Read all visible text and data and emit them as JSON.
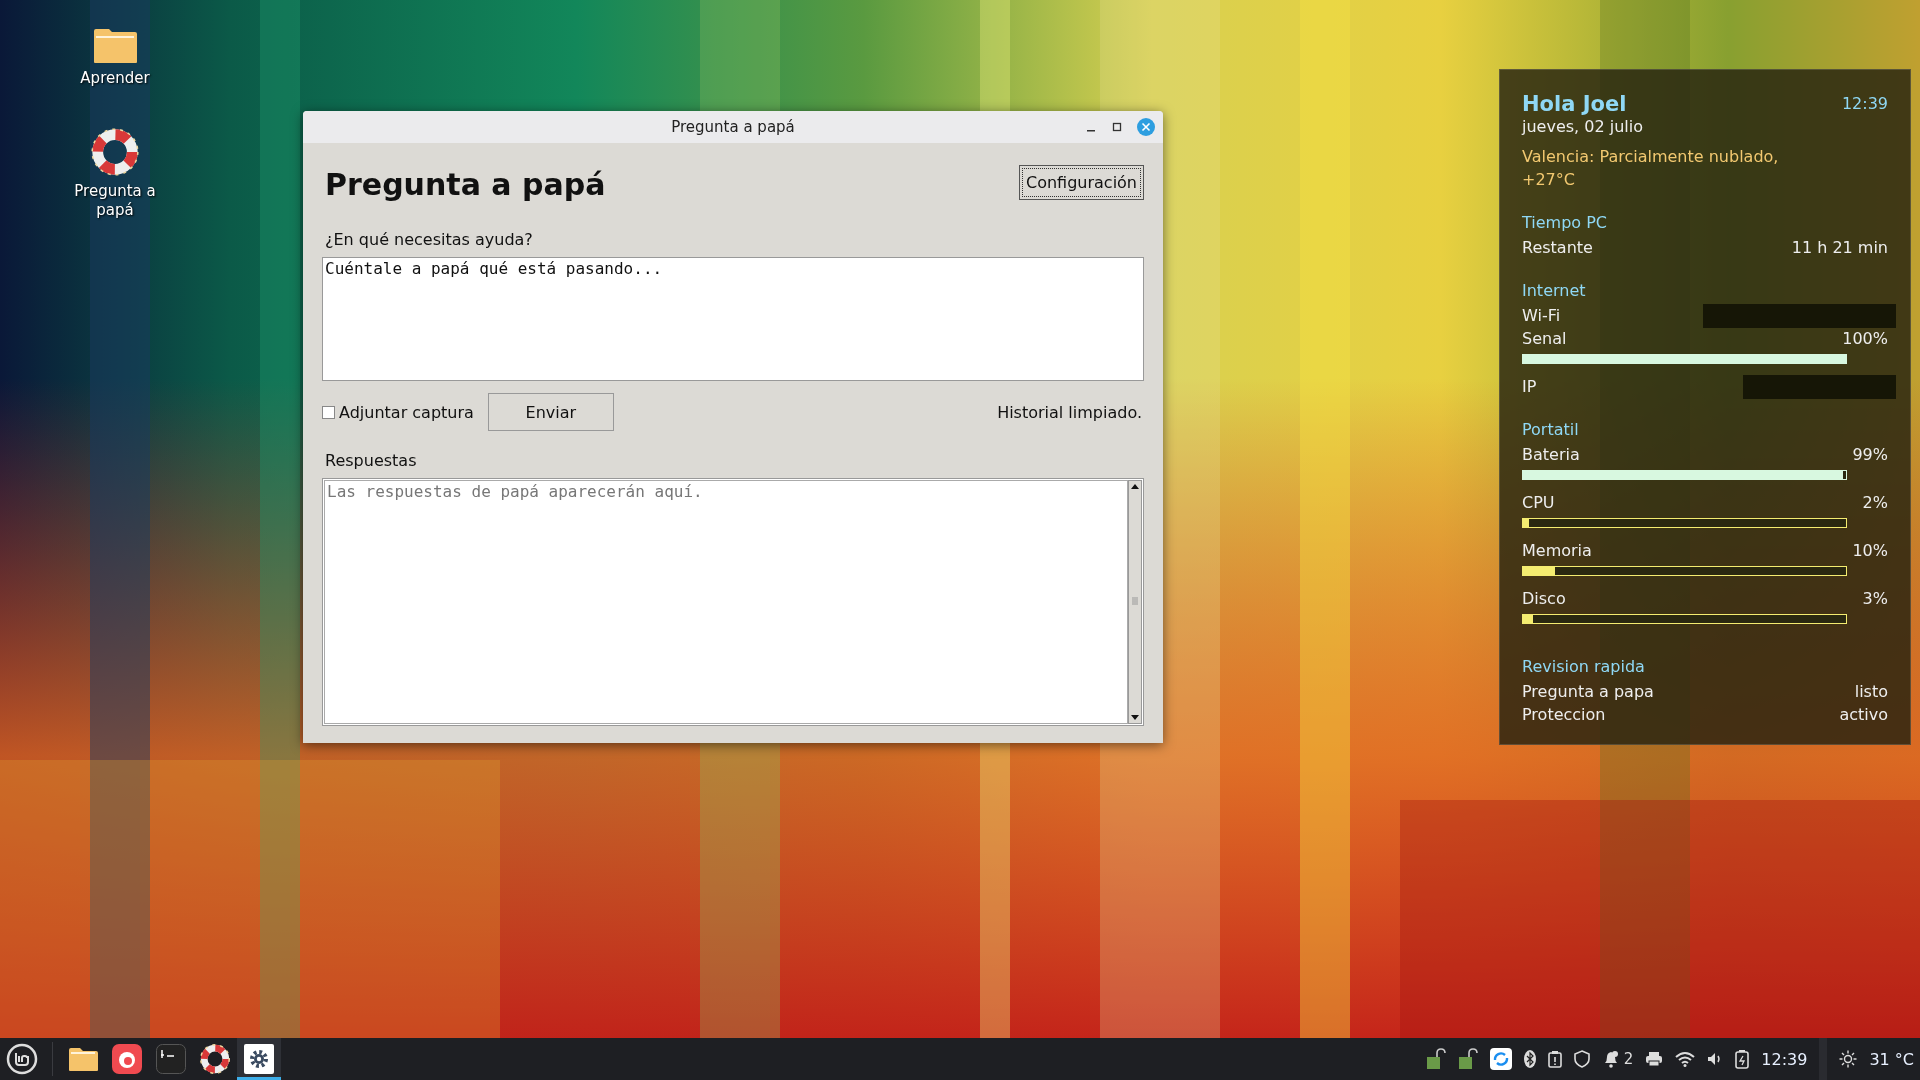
{
  "desktop_icons": [
    {
      "kind": "folder",
      "label": "Aprender"
    },
    {
      "kind": "lifebuoy",
      "label": "Pregunta a papá"
    }
  ],
  "window": {
    "title": "Pregunta a papá",
    "heading": "Pregunta a papá",
    "settings_button": "Configuración",
    "question_label": "¿En qué necesitas ayuda?",
    "question_value": "Cuéntale a papá qué está pasando...",
    "attach": {
      "label": "Adjuntar captura",
      "checked": false
    },
    "send_button": "Enviar",
    "status": "Historial limpiado.",
    "answers_label": "Respuestas",
    "answers_placeholder": "Las respuestas de papá aparecerán aquí."
  },
  "widget": {
    "greeting": "Hola Joel",
    "time": "12:39",
    "date": "jueves, 02 julio",
    "weather": "Valencia: Parcialmente nublado, +27°C",
    "sections": [
      {
        "title": "Tiempo PC",
        "rows": [
          {
            "kind": "text",
            "label": "Restante",
            "value": "11 h 21 min"
          }
        ]
      },
      {
        "title": "Internet",
        "rows": [
          {
            "kind": "redacted",
            "label": "Wi-Fi"
          },
          {
            "kind": "meter",
            "label": "Senal",
            "value": "100%",
            "level": 1.0,
            "color": "#d8f8e0"
          },
          {
            "kind": "redacted",
            "label": "IP"
          }
        ]
      },
      {
        "title": "Portatil",
        "rows": [
          {
            "kind": "meter",
            "label": "Bateria",
            "value": "99%",
            "level": 0.99,
            "color": "#d8f8e0"
          },
          {
            "kind": "meter",
            "label": "CPU",
            "value": "2%",
            "level": 0.02,
            "color": "#f4ec70"
          },
          {
            "kind": "meter",
            "label": "Memoria",
            "value": "10%",
            "level": 0.1,
            "color": "#f4ec70"
          },
          {
            "kind": "meter",
            "label": "Disco",
            "value": "3%",
            "level": 0.03,
            "color": "#f4ec70"
          }
        ]
      },
      {
        "title": "Revision rapida",
        "rows": [
          {
            "kind": "text",
            "label": "Pregunta a papa",
            "value": "listo"
          },
          {
            "kind": "text",
            "label": "Proteccion",
            "value": "activo"
          }
        ]
      }
    ]
  },
  "taskbar": {
    "apps": [
      {
        "kind": "folder",
        "active": false
      },
      {
        "kind": "browser",
        "active": false
      },
      {
        "kind": "terminal",
        "active": false
      },
      {
        "kind": "lifebuoy",
        "active": false
      },
      {
        "kind": "settings",
        "active": true
      }
    ],
    "tray": [
      {
        "kind": "lock"
      },
      {
        "kind": "lock"
      },
      {
        "kind": "sync"
      },
      {
        "kind": "bluetooth"
      },
      {
        "kind": "clipboard"
      },
      {
        "kind": "shield"
      },
      {
        "kind": "notifications",
        "count": "2"
      },
      {
        "kind": "printer"
      },
      {
        "kind": "wifi"
      },
      {
        "kind": "volume"
      },
      {
        "kind": "battery"
      }
    ],
    "clock": "12:39",
    "weather": "31 °C"
  }
}
